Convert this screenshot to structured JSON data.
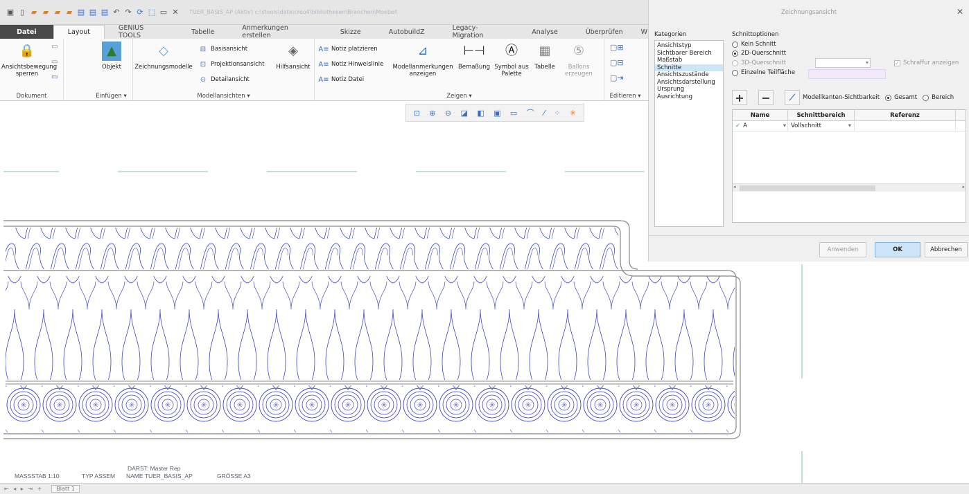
{
  "quick_access": {
    "icons": [
      "window-icon",
      "new-icon",
      "open-icon",
      "open-icon",
      "open-icon",
      "open-icon",
      "save-icon",
      "save-icon",
      "save-icon",
      "undo-icon",
      "redo-icon",
      "regenerate-icon",
      "select-icon",
      "window-icon",
      "close-icon"
    ],
    "title": "TUER_BASIS_AP (Aktiv) c:\\stools\\data\\creo4\\bibliotheken\\Branchen\\Moebel\\"
  },
  "tabs": [
    "Datei",
    "Layout",
    "GENIUS TOOLS",
    "Tabelle",
    "Anmerkungen erstellen",
    "Skizze",
    "AutobuildZ",
    "Legacy-Migration",
    "Analyse",
    "Überprüfen",
    "W"
  ],
  "active_tab": "Layout",
  "ribbon": {
    "dokument": {
      "button": "Ansichtsbewegung sperren",
      "label": "Dokument"
    },
    "einfuegen": {
      "button": "Objekt",
      "label": "Einfügen"
    },
    "modellansichten": {
      "zeichnungsmodelle": "Zeichnungsmodelle",
      "basis": "Basisansicht",
      "projektion": "Projektionsansicht",
      "detail": "Detailansicht",
      "hilfs": "Hilfsansicht",
      "label": "Modellansichten"
    },
    "zeigen": {
      "notiz_platzieren": "Notiz platzieren",
      "notiz_hinweis": "Notiz Hinweislinie",
      "notiz_datei": "Notiz Datei",
      "modellanm": "Modellanmerkungen anzeigen",
      "bemassung": "Bemaßung",
      "symbol": "Symbol aus Palette",
      "tabelle": "Tabelle",
      "ballons": "Ballons erzeugen",
      "label": "Zeigen"
    },
    "editieren": {
      "label": "Editieren"
    }
  },
  "view_toolbar": [
    "zoom-fit-icon",
    "zoom-in-icon",
    "zoom-out-icon",
    "repaint-icon",
    "shading-icon",
    "view-icon",
    "view-icon",
    "datum-icon",
    "axis-icon",
    "point-icon",
    "csys-icon"
  ],
  "drawing_footer": {
    "darst": "DARST: Master Rep",
    "massstab": "MASSSTAB 1:10",
    "typ": "TYP ASSEM",
    "name": "NAME TUER_BASIS_AP",
    "groesse": "GRÖSSE A3"
  },
  "statusbar": {
    "nav": "⇤ ◂ ▸ ⇥ +",
    "sheet": "Blatt 1"
  },
  "dialog": {
    "title": "Zeichnungsansicht",
    "kategorien_label": "Kategorien",
    "kategorien": [
      "Ansichtstyp",
      "Sichtbarer Bereich",
      "Maßstab",
      "Schnitte",
      "Ansichtszustände",
      "Ansichtsdarstellung",
      "Ursprung",
      "Ausrichtung"
    ],
    "selected_kategorie": "Schnitte",
    "schnittoptionen_label": "Schnittoptionen",
    "opt_kein": "Kein Schnitt",
    "opt_2d": "2D-Querschnitt",
    "opt_3d": "3D-Querschnitt",
    "opt_einzel": "Einzelne Teilfläche",
    "schraffur": "Schraffur anzeigen",
    "modellkanten": "Modellkanten-Sichtbarkeit",
    "gesamt": "Gesamt",
    "bereich": "Bereich",
    "table_headers": [
      "Name",
      "Schnittbereich",
      "Referenz"
    ],
    "table_row": {
      "name": "A",
      "bereich": "Vollschnitt",
      "referenz": ""
    },
    "btn_anwenden": "Anwenden",
    "btn_ok": "OK",
    "btn_abbrechen": "Abbrechen"
  }
}
